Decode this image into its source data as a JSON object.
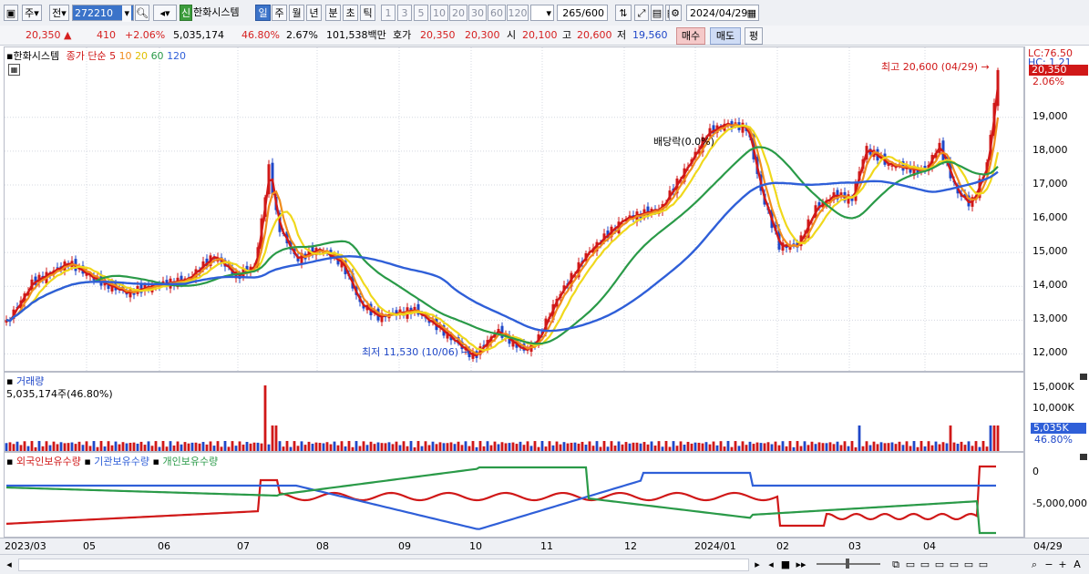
{
  "toolbar": {
    "type_label": "주",
    "prev_label": "전",
    "code": "272210",
    "shin": "신",
    "name": "한화시스템",
    "periods": [
      "일",
      "주",
      "월",
      "년",
      "분",
      "초",
      "틱"
    ],
    "intervals": [
      "1",
      "3",
      "5",
      "10",
      "20",
      "30",
      "60",
      "120"
    ],
    "count": "265",
    "count_max": "/600",
    "date": "2024/04/29"
  },
  "info": {
    "price": "20,350 ▲",
    "change": "410",
    "change_pct": "+2.06%",
    "volume": "5,035,174",
    "vol_ratio": "46.80%",
    "turnover": "2.67%",
    "amount": "101,538백만",
    "hoga_label": "호가",
    "ask": "20,350",
    "bid": "20,300",
    "open_label": "시",
    "open": "20,100",
    "high_label": "고",
    "high": "20,600",
    "low_label": "저",
    "low": "19,560",
    "buy": "매수",
    "sell": "매도",
    "avg": "평"
  },
  "price_panel": {
    "title": "한화시스템",
    "legend_label": "종가 단순",
    "ma": [
      {
        "label": "5",
        "color": "#d01818"
      },
      {
        "label": "10",
        "color": "#f08c1c"
      },
      {
        "label": "20",
        "color": "#f0d81c"
      },
      {
        "label": "60",
        "color": "#2a9a48"
      },
      {
        "label": "120",
        "color": "#2f5fd8"
      }
    ],
    "y_ticks": [
      "19,000",
      "18,000",
      "17,000",
      "16,000",
      "15,000",
      "14,000",
      "13,000",
      "12,000"
    ],
    "annotations": {
      "high": "최고 20,600 (04/29)",
      "low": "최저 11,530 (10/06)",
      "dividend": "배당락(0.0%)"
    },
    "badges": {
      "lc": "LC:76.50",
      "hc": "HC: 1.21",
      "price": "20,350",
      "pct": "2.06%"
    }
  },
  "volume_panel": {
    "title": "거래량",
    "value": "5,035,174주(46.80%)",
    "y_ticks": [
      "15,000K",
      "10,000K"
    ],
    "badge_value": "5,035K",
    "badge_pct": "46.80%"
  },
  "holder_panel": {
    "legend": [
      {
        "label": "외국인보유수량",
        "color": "#d01818"
      },
      {
        "label": "기관보유수량",
        "color": "#2f5fd8"
      },
      {
        "label": "개인보유수량",
        "color": "#2a9a48"
      }
    ],
    "y_ticks": [
      "0",
      "-5,000,000"
    ]
  },
  "xaxis": {
    "labels": [
      "2023/03",
      "05",
      "06",
      "07",
      "08",
      "09",
      "10",
      "11",
      "12",
      "2024/01",
      "02",
      "03",
      "04"
    ],
    "right_label": "04/29"
  },
  "colors": {
    "up": "#d01818",
    "down": "#1f47c8",
    "ma5": "#d01818",
    "ma10": "#f08c1c",
    "ma20": "#f0d81c",
    "ma60": "#2a9a48",
    "ma120": "#2f5fd8"
  }
}
